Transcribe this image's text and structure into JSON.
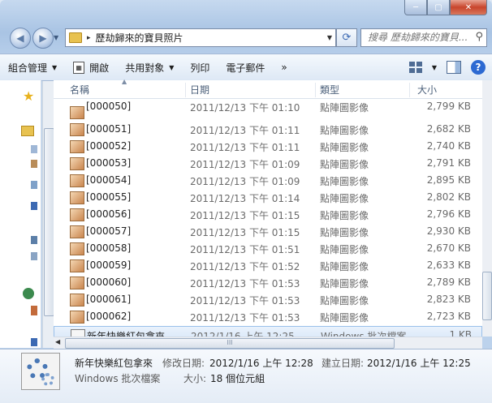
{
  "window": {
    "controls": {
      "minimize": "─",
      "maximize": "▢",
      "close": "✕"
    }
  },
  "address_bar": {
    "path_separator": "▸",
    "path": "歷劫歸來的寶貝照片",
    "search_placeholder": "搜尋 歷劫歸來的寶貝..."
  },
  "toolbar": {
    "organize": "組合管理",
    "open": "開啟",
    "share": "共用對象",
    "print": "列印",
    "email": "電子郵件",
    "more": "»"
  },
  "columns": {
    "name": "名稱",
    "date": "日期",
    "type": "類型",
    "size": "大小"
  },
  "files": [
    {
      "name": "[000050]",
      "date": "2011/12/13 下午 01:10",
      "type": "點陣圖影像",
      "size": "2,799 KB"
    },
    {
      "name": "[000051]",
      "date": "2011/12/13 下午 01:11",
      "type": "點陣圖影像",
      "size": "2,682 KB"
    },
    {
      "name": "[000052]",
      "date": "2011/12/13 下午 01:11",
      "type": "點陣圖影像",
      "size": "2,740 KB"
    },
    {
      "name": "[000053]",
      "date": "2011/12/13 下午 01:09",
      "type": "點陣圖影像",
      "size": "2,791 KB"
    },
    {
      "name": "[000054]",
      "date": "2011/12/13 下午 01:09",
      "type": "點陣圖影像",
      "size": "2,895 KB"
    },
    {
      "name": "[000055]",
      "date": "2011/12/13 下午 01:14",
      "type": "點陣圖影像",
      "size": "2,802 KB"
    },
    {
      "name": "[000056]",
      "date": "2011/12/13 下午 01:15",
      "type": "點陣圖影像",
      "size": "2,796 KB"
    },
    {
      "name": "[000057]",
      "date": "2011/12/13 下午 01:15",
      "type": "點陣圖影像",
      "size": "2,930 KB"
    },
    {
      "name": "[000058]",
      "date": "2011/12/13 下午 01:51",
      "type": "點陣圖影像",
      "size": "2,670 KB"
    },
    {
      "name": "[000059]",
      "date": "2011/12/13 下午 01:52",
      "type": "點陣圖影像",
      "size": "2,633 KB"
    },
    {
      "name": "[000060]",
      "date": "2011/12/13 下午 01:53",
      "type": "點陣圖影像",
      "size": "2,789 KB"
    },
    {
      "name": "[000061]",
      "date": "2011/12/13 下午 01:53",
      "type": "點陣圖影像",
      "size": "2,823 KB"
    },
    {
      "name": "[000062]",
      "date": "2011/12/13 下午 01:53",
      "type": "點陣圖影像",
      "size": "2,723 KB"
    },
    {
      "name": "新年快樂紅包拿來",
      "date": "2012/1/16 上午 12:25",
      "type": "Windows 批次檔案",
      "size": "1 KB"
    }
  ],
  "details": {
    "name": "新年快樂紅包拿來",
    "type": "Windows 批次檔案",
    "modified_label": "修改日期:",
    "modified": "2012/1/16 上午 12:28",
    "created_label": "建立日期:",
    "created": "2012/1/16 上午 12:25",
    "size_label": "大小:",
    "size": "18 個位元組"
  },
  "scroll": {
    "hscroll_grip": "III"
  },
  "colors": {
    "selection": "#d7e6f8",
    "accent": "#2d6ad2"
  }
}
